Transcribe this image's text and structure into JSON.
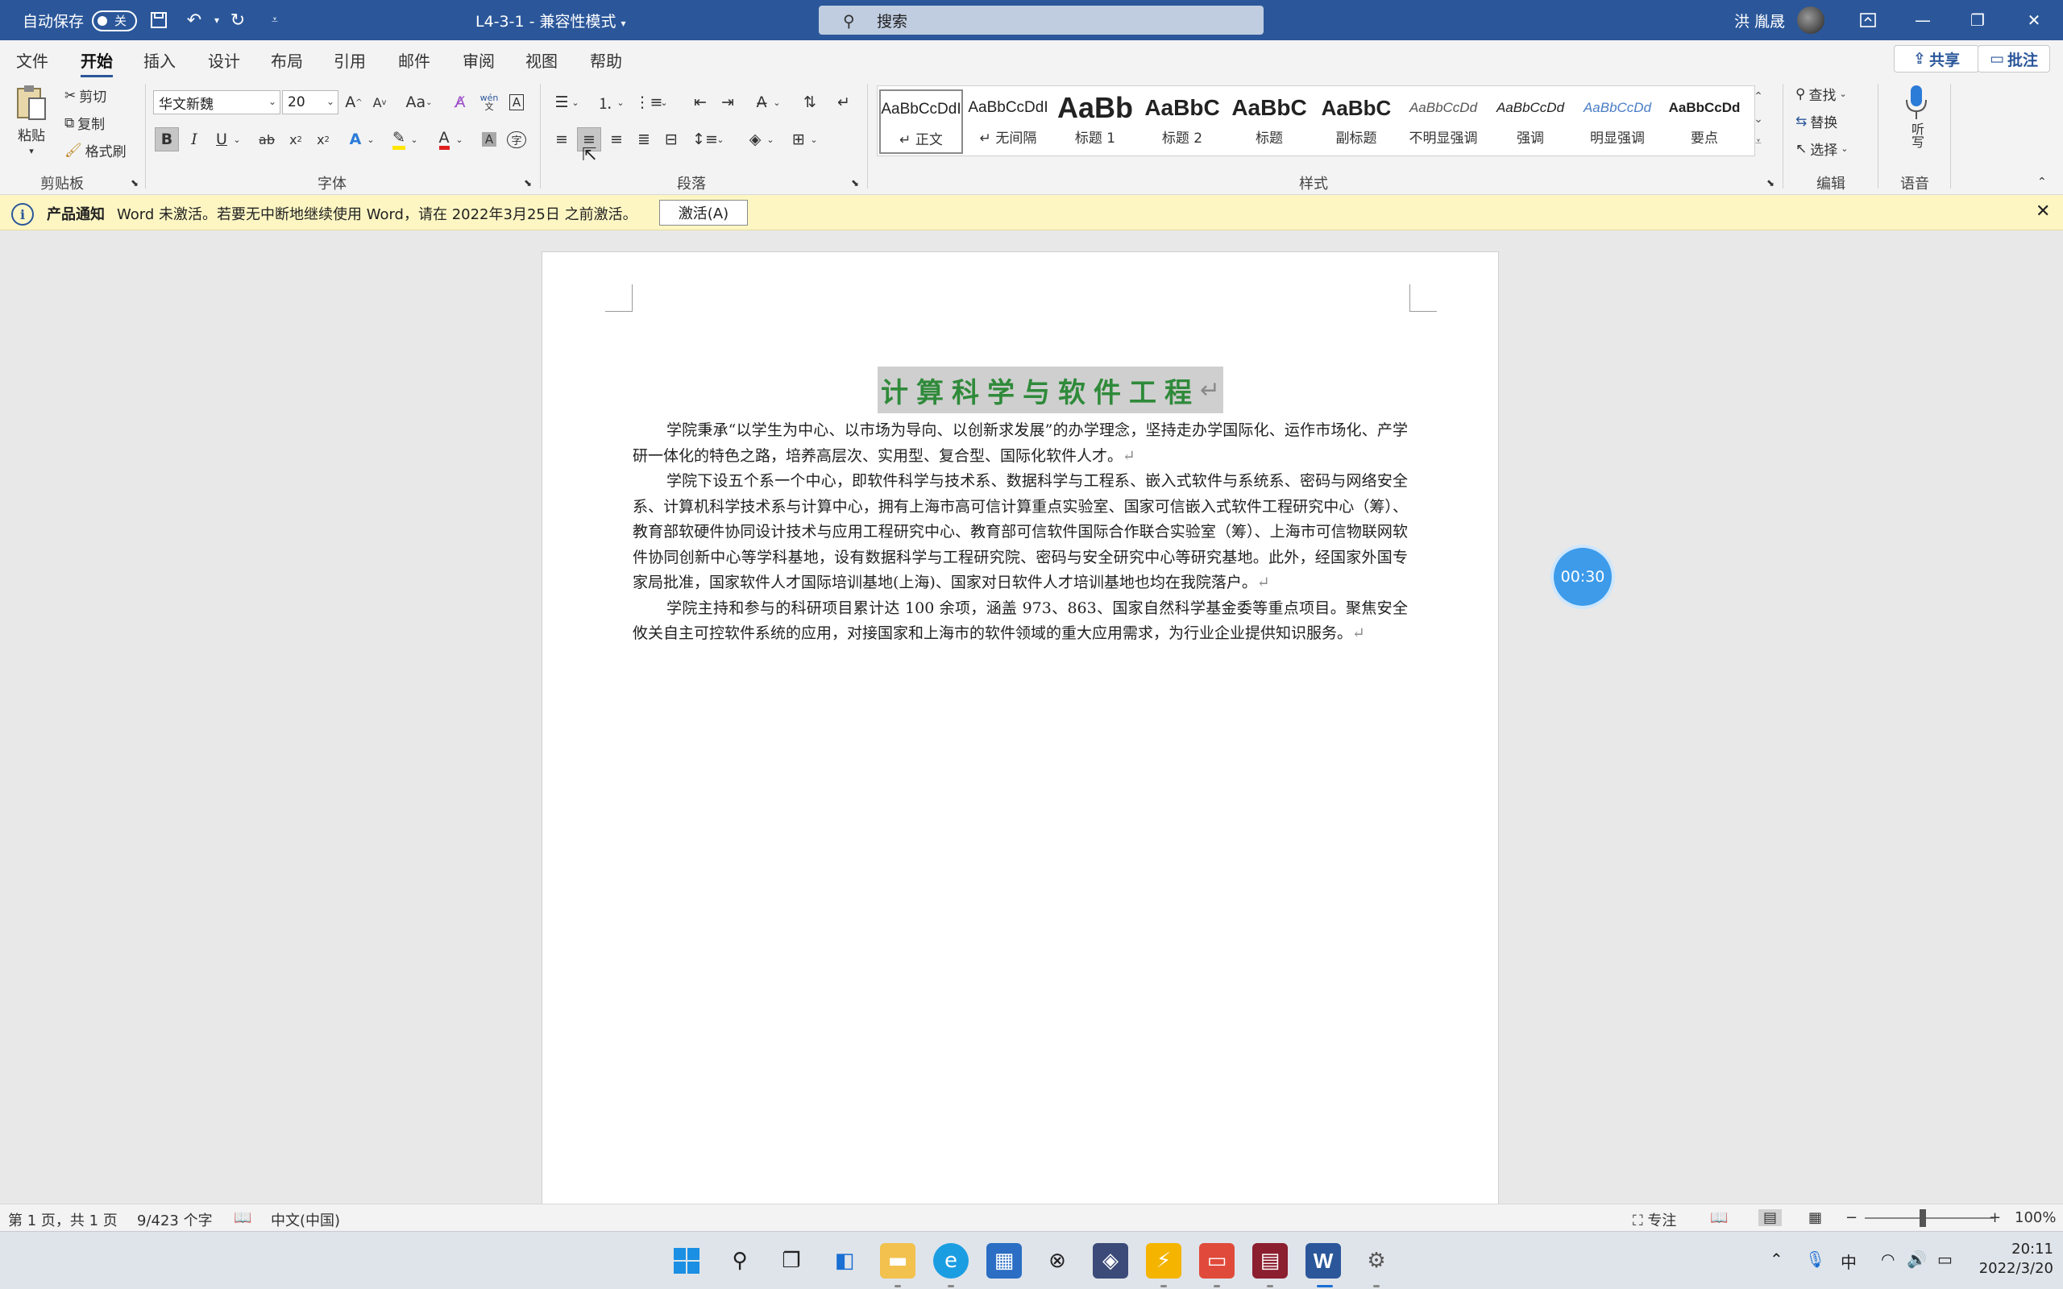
{
  "titlebar": {
    "autosave_label": "自动保存",
    "autosave_state": "关",
    "doc_title": "L4-3-1  -  兼容性模式",
    "search_placeholder": "搜索",
    "user_name": "洪 胤晟"
  },
  "menu": {
    "tabs": [
      "文件",
      "开始",
      "插入",
      "设计",
      "布局",
      "引用",
      "邮件",
      "审阅",
      "视图",
      "帮助"
    ],
    "active": "开始",
    "share_label": "共享",
    "comment_label": "批注"
  },
  "ribbon": {
    "clipboard": {
      "paste": "粘贴",
      "cut": "剪切",
      "copy": "复制",
      "format_painter": "格式刷",
      "label": "剪贴板"
    },
    "font": {
      "name": "华文新魏",
      "size": "20",
      "grow": "A",
      "shrink": "A",
      "case": "Aa",
      "label": "字体",
      "phonetic": "wén"
    },
    "paragraph": {
      "label": "段落"
    },
    "styles": {
      "label": "样式",
      "items": [
        {
          "preview": "AaBbCcDdI",
          "name": "↵ 正文"
        },
        {
          "preview": "AaBbCcDdI",
          "name": "↵ 无间隔"
        },
        {
          "preview": "AaBb",
          "name": "标题 1"
        },
        {
          "preview": "AaBbC",
          "name": "标题 2"
        },
        {
          "preview": "AaBbC",
          "name": "标题"
        },
        {
          "preview": "AaBbC",
          "name": "副标题"
        },
        {
          "preview": "AaBbCcDd",
          "name": "不明显强调"
        },
        {
          "preview": "AaBbCcDd",
          "name": "强调"
        },
        {
          "preview": "AaBbCcDd",
          "name": "明显强调"
        },
        {
          "preview": "AaBbCcDd",
          "name": "要点"
        }
      ]
    },
    "editing": {
      "find": "查找",
      "replace": "替换",
      "select": "选择",
      "label": "编辑"
    },
    "voice": {
      "dictate": "听写",
      "label": "语音"
    }
  },
  "notification": {
    "title": "产品通知",
    "message": "Word 未激活。若要无中断地继续使用 Word，请在 2022年3月25日 之前激活。",
    "button": "激活(A)"
  },
  "document": {
    "title": "计算科学与软件工程",
    "paragraphs": [
      "学院秉承“以学生为中心、以市场为导向、以创新求发展”的办学理念，坚持走办学国际化、运作市场化、产学研一体化的特色之路，培养高层次、实用型、复合型、国际化软件人才。",
      "学院下设五个系一个中心，即软件科学与技术系、数据科学与工程系、嵌入式软件与系统系、密码与网络安全系、计算机科学技术系与计算中心，拥有上海市高可信计算重点实验室、国家可信嵌入式软件工程研究中心（筹）、教育部软硬件协同设计技术与应用工程研究中心、教育部可信软件国际合作联合实验室（筹）、上海市可信物联网软件协同创新中心等学科基地，设有数据科学与工程研究院、密码与安全研究中心等研究基地。此外，经国家外国专家局批准，国家软件人才国际培训基地(上海)、国家对日软件人才培训基地也均在我院落户。",
      "学院主持和参与的科研项目累计达 100 余项，涵盖 973、863、国家自然科学基金委等重点项目。聚焦安全攸关自主可控软件系统的应用，对接国家和上海市的软件领域的重大应用需求，为行业企业提供知识服务。"
    ],
    "timer": "00:30"
  },
  "status": {
    "page": "第 1 页，共 1 页",
    "words": "9/423 个字",
    "language": "中文(中国)",
    "focus": "专注",
    "zoom": "100%"
  },
  "taskbar": {
    "ime": "中",
    "time": "20:11",
    "date": "2022/3/20"
  },
  "colors": {
    "accent": "#2b579a",
    "title_green": "#2f8a3a",
    "notification_bg": "#fdf6c3",
    "timer_blue": "#3d9bea"
  }
}
